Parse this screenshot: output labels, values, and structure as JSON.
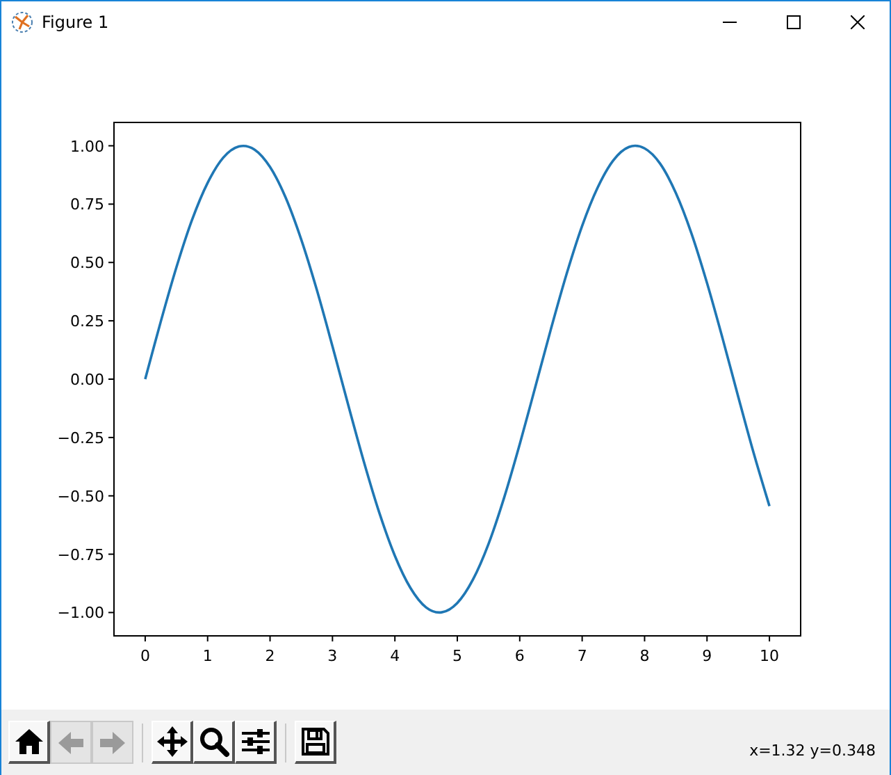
{
  "window": {
    "title": "Figure 1"
  },
  "figure": {
    "chart_data": {
      "type": "line",
      "xlim": [
        -0.5,
        10.5
      ],
      "ylim": [
        -1.1,
        1.1
      ],
      "xticks": [
        0,
        1,
        2,
        3,
        4,
        5,
        6,
        7,
        8,
        9,
        10
      ],
      "yticks": [
        {
          "value": 1,
          "label": "1.00"
        },
        {
          "value": 0.75,
          "label": "0.75"
        },
        {
          "value": 0.5,
          "label": "0.50"
        },
        {
          "value": 0.25,
          "label": "0.25"
        },
        {
          "value": 0,
          "label": "0.00"
        },
        {
          "value": -0.25,
          "label": "−0.25"
        },
        {
          "value": -0.5,
          "label": "−0.50"
        },
        {
          "value": -0.75,
          "label": "−0.75"
        },
        {
          "value": -1,
          "label": "−1.00"
        }
      ],
      "x": [
        0,
        0.25,
        0.5,
        0.75,
        1,
        1.25,
        1.5,
        1.75,
        2,
        2.25,
        2.5,
        2.75,
        3,
        3.25,
        3.5,
        3.75,
        4,
        4.25,
        4.5,
        4.75,
        5,
        5.25,
        5.5,
        5.75,
        6,
        6.25,
        6.5,
        6.75,
        7,
        7.25,
        7.5,
        7.75,
        8,
        8.25,
        8.5,
        8.75,
        9,
        9.25,
        9.5,
        9.75,
        10
      ],
      "series": [
        {
          "color": "#1f77b4",
          "values": [
            0,
            0.247,
            0.479,
            0.682,
            0.841,
            0.949,
            0.997,
            0.984,
            0.909,
            0.778,
            0.598,
            0.382,
            0.141,
            -0.108,
            -0.351,
            -0.572,
            -0.757,
            -0.895,
            -0.978,
            -0.999,
            -0.959,
            -0.859,
            -0.706,
            -0.508,
            -0.279,
            -0.033,
            0.215,
            0.45,
            0.657,
            0.822,
            0.938,
            0.995,
            0.989,
            0.923,
            0.798,
            0.625,
            0.412,
            0.174,
            -0.075,
            -0.319,
            -0.544
          ]
        }
      ]
    }
  },
  "toolbar": {
    "groups": [
      {
        "buttons": [
          {
            "kind": "home",
            "disabled": false
          },
          {
            "kind": "back",
            "disabled": true
          },
          {
            "kind": "forward",
            "disabled": true
          }
        ]
      },
      {
        "buttons": [
          {
            "kind": "pan",
            "disabled": false
          },
          {
            "kind": "zoom",
            "disabled": false
          },
          {
            "kind": "configure",
            "disabled": false
          }
        ]
      },
      {
        "buttons": [
          {
            "kind": "save",
            "disabled": false
          }
        ]
      }
    ]
  },
  "status": "x=1.32 y=0.348"
}
